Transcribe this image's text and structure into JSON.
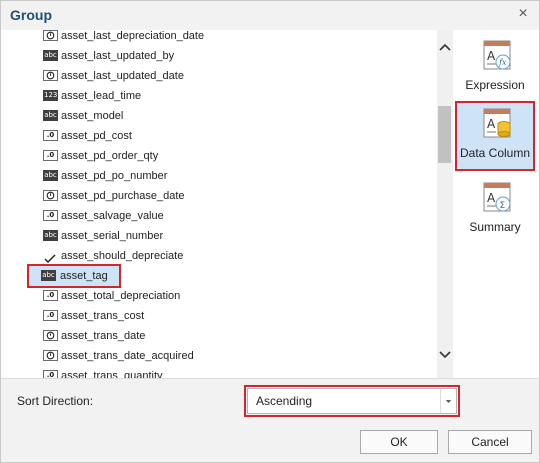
{
  "dialog": {
    "title": "Group",
    "close_glyph": "×"
  },
  "fields": [
    {
      "type": "date",
      "type_label": "",
      "name": "asset_last_depreciation_date"
    },
    {
      "type": "string",
      "type_label": "abc",
      "name": "asset_last_updated_by"
    },
    {
      "type": "date",
      "type_label": "",
      "name": "asset_last_updated_date"
    },
    {
      "type": "integer",
      "type_label": "123",
      "name": "asset_lead_time"
    },
    {
      "type": "string",
      "type_label": "abc",
      "name": "asset_model"
    },
    {
      "type": "decimal",
      "type_label": ".0",
      "name": "asset_pd_cost"
    },
    {
      "type": "decimal",
      "type_label": ".0",
      "name": "asset_pd_order_qty"
    },
    {
      "type": "string",
      "type_label": "abc",
      "name": "asset_pd_po_number"
    },
    {
      "type": "date",
      "type_label": "",
      "name": "asset_pd_purchase_date"
    },
    {
      "type": "decimal",
      "type_label": ".0",
      "name": "asset_salvage_value"
    },
    {
      "type": "string",
      "type_label": "abc",
      "name": "asset_serial_number"
    },
    {
      "type": "boolean",
      "type_label": "",
      "name": "asset_should_depreciate"
    },
    {
      "type": "string",
      "type_label": "abc",
      "name": "asset_tag",
      "selected": true
    },
    {
      "type": "decimal",
      "type_label": ".0",
      "name": "asset_total_depreciation"
    },
    {
      "type": "decimal",
      "type_label": ".0",
      "name": "asset_trans_cost"
    },
    {
      "type": "date",
      "type_label": "",
      "name": "asset_trans_date"
    },
    {
      "type": "date",
      "type_label": "",
      "name": "asset_trans_date_acquired"
    },
    {
      "type": "decimal",
      "type_label": ".0",
      "name": "asset_trans_quantity"
    }
  ],
  "scroll": {
    "position_fraction": 0.27
  },
  "tools": [
    {
      "id": "expression",
      "label": "Expression",
      "icon": "expression-icon",
      "active": false
    },
    {
      "id": "data-column",
      "label": "Data Column",
      "icon": "data-column-icon",
      "active": true
    },
    {
      "id": "summary",
      "label": "Summary",
      "icon": "summary-icon",
      "active": false
    }
  ],
  "sort": {
    "label": "Sort Direction:",
    "value": "Ascending"
  },
  "buttons": {
    "ok": "OK",
    "cancel": "Cancel"
  },
  "colors": {
    "title": "#1f4e79",
    "highlight": "#d0262d",
    "selection": "#cfe3f7"
  }
}
